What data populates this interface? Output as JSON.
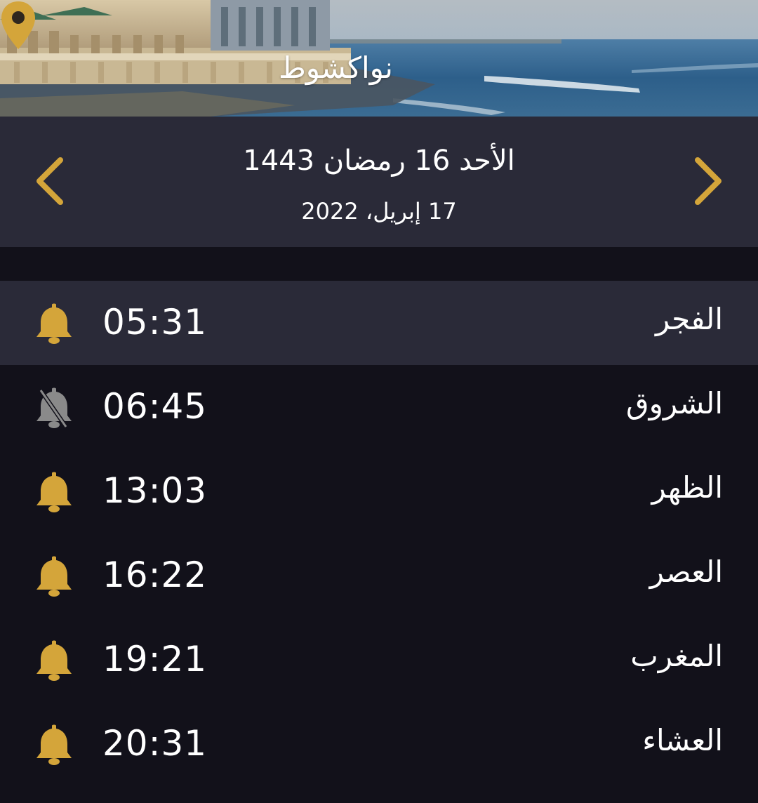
{
  "header": {
    "location": "نواكشوط",
    "accent_color": "#D4A53A"
  },
  "date": {
    "hijri": "الأحد 16 رمضان 1443",
    "gregorian": "17 إبريل، 2022"
  },
  "prayers": [
    {
      "name": "الفجر",
      "time": "05:31",
      "alarm": "on",
      "current": true
    },
    {
      "name": "الشروق",
      "time": "06:45",
      "alarm": "off",
      "current": false
    },
    {
      "name": "الظهر",
      "time": "13:03",
      "alarm": "on",
      "current": false
    },
    {
      "name": "العصر",
      "time": "16:22",
      "alarm": "on",
      "current": false
    },
    {
      "name": "المغرب",
      "time": "19:21",
      "alarm": "on",
      "current": false
    },
    {
      "name": "العشاء",
      "time": "20:31",
      "alarm": "on",
      "current": false
    }
  ],
  "colors": {
    "background": "#12111A",
    "panel": "#2A2A38",
    "alarm_on": "#D4A53A",
    "alarm_off": "#8A8A8A"
  }
}
